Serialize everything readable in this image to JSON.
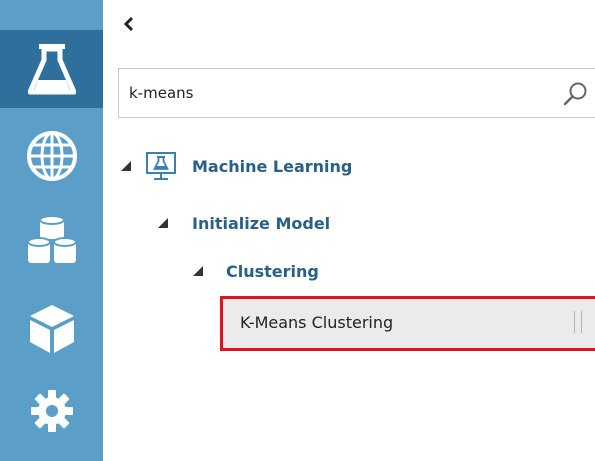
{
  "sidebar": {
    "items": [
      {
        "icon": "flask-icon",
        "active": true
      },
      {
        "icon": "globe-icon",
        "active": false
      },
      {
        "icon": "datasets-icon",
        "active": false
      },
      {
        "icon": "cube-icon",
        "active": false
      },
      {
        "icon": "gear-icon",
        "active": false
      }
    ],
    "colors": {
      "rail": "#5b9fc9",
      "active": "#2f6f9b"
    }
  },
  "panel": {
    "collapse_icon": "chevron-left-icon"
  },
  "search": {
    "value": "k-means",
    "icon": "search-icon"
  },
  "tree": {
    "root": {
      "label": "Machine Learning",
      "icon": "machine-learning-icon",
      "expanded": true
    },
    "level1": {
      "label": "Initialize Model",
      "expanded": true
    },
    "level2": {
      "label": "Clustering",
      "expanded": true
    },
    "leaf": {
      "label": "K-Means Clustering",
      "selected": true,
      "highlight_color": "#e0141e"
    }
  },
  "colors": {
    "tree_text": "#2a5f86",
    "selected_bg": "#ebebeb"
  }
}
